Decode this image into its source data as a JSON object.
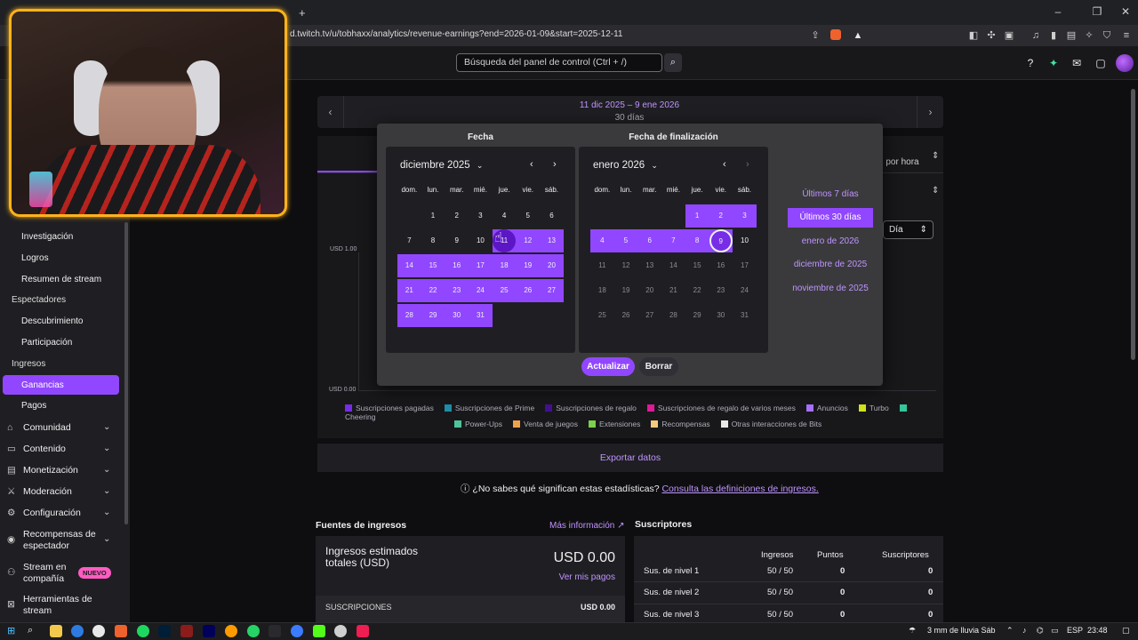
{
  "browser": {
    "url": "d.twitch.tv/u/tobhaxx/analytics/revenue-earnings?end=2026-01-09&start=2025-12-11",
    "new_tab": "+",
    "minimize": "–",
    "maximize": "❐",
    "close": "✕"
  },
  "topnav": {
    "search_placeholder": "Búsqueda del panel de control (Ctrl + /)"
  },
  "sidebar": {
    "items": [
      {
        "label": "Investigación"
      },
      {
        "label": "Logros"
      },
      {
        "label": "Resumen de stream"
      }
    ],
    "head_viewers": "Espectadores",
    "viewer_items": [
      {
        "label": "Descubrimiento"
      },
      {
        "label": "Participación"
      }
    ],
    "head_revenue": "Ingresos",
    "revenue_items": [
      {
        "label": "Ganancias",
        "active": true
      },
      {
        "label": "Pagos"
      }
    ],
    "sections": [
      {
        "label": "Comunidad",
        "icon": "community-icon"
      },
      {
        "label": "Contenido",
        "icon": "content-icon"
      },
      {
        "label": "Monetización",
        "icon": "monetization-icon"
      },
      {
        "label": "Moderación",
        "icon": "moderation-icon"
      },
      {
        "label": "Configuración",
        "icon": "settings-icon"
      },
      {
        "label": "Recompensas de espectador",
        "icon": "rewards-icon"
      },
      {
        "label": "Stream en compañía",
        "icon": "collab-icon"
      },
      {
        "label": "Herramientas de stream",
        "icon": "tools-icon"
      }
    ],
    "new_badge": "NUEVO"
  },
  "daterange": {
    "range": "11 dic 2025 – 9 ene 2026",
    "days": "30 días",
    "prev": "‹",
    "next": "›"
  },
  "chart": {
    "view_select": "d por hora",
    "granularity": "Día",
    "y_top": "USD 1.00",
    "y_bottom": "USD 0.00",
    "legend": [
      {
        "label": "Suscripciones pagadas",
        "color": "#772ce8"
      },
      {
        "label": "Suscripciones de Prime",
        "color": "#1f8fa8"
      },
      {
        "label": "Suscripciones de regalo",
        "color": "#451093"
      },
      {
        "label": "Suscripciones de regalo de varios meses",
        "color": "#e31a9a"
      },
      {
        "label": "Anuncios",
        "color": "#a970ff"
      },
      {
        "label": "Turbo",
        "color": "#d2e41a"
      },
      {
        "label": "Cheering",
        "color": "#33c69b"
      },
      {
        "label": "Power-Ups",
        "color": "#4fc49a"
      },
      {
        "label": "Venta de juegos",
        "color": "#f0a24a"
      },
      {
        "label": "Extensiones",
        "color": "#7bd14a"
      },
      {
        "label": "Recompensas",
        "color": "#f7c97a"
      },
      {
        "label": "Otras interacciones de Bits",
        "color": "#e8e8e8"
      }
    ]
  },
  "export_label": "Exportar datos",
  "help": {
    "question": "¿No sabes qué significan estas estadísticas?",
    "link": "Consulta las definiciones de ingresos."
  },
  "revenue": {
    "title": "Fuentes de ingresos",
    "more": "Más información",
    "estimated_label": "Ingresos estimados totales (USD)",
    "estimated_value": "USD 0.00",
    "payouts_link": "Ver mis pagos",
    "subs_label": "SUSCRIPCIONES",
    "subs_value": "USD 0.00"
  },
  "subscribers": {
    "title": "Suscriptores",
    "columns": [
      "Ingresos",
      "Puntos",
      "Suscriptores"
    ],
    "rows": [
      {
        "tier": "Sus. de nivel 1",
        "revenue": "50 / 50",
        "points": "0",
        "subs": "0"
      },
      {
        "tier": "Sus. de nivel 2",
        "revenue": "50 / 50",
        "points": "0",
        "subs": "0"
      },
      {
        "tier": "Sus. de nivel 3",
        "revenue": "50 / 50",
        "points": "0",
        "subs": "0"
      }
    ]
  },
  "datepicker": {
    "start_title": "Fecha",
    "end_title": "Fecha de finalización",
    "weekdays": [
      "dom.",
      "lun.",
      "mar.",
      "mié.",
      "jue.",
      "vie.",
      "sáb."
    ],
    "left_month": "diciembre 2025",
    "right_month": "enero 2026",
    "left_weeks": [
      [
        "",
        "1",
        "2",
        "3",
        "4",
        "5",
        "6"
      ],
      [
        "7",
        "8",
        "9",
        "10",
        "11",
        "12",
        "13"
      ],
      [
        "14",
        "15",
        "16",
        "17",
        "18",
        "19",
        "20"
      ],
      [
        "21",
        "22",
        "23",
        "24",
        "25",
        "26",
        "27"
      ],
      [
        "28",
        "29",
        "30",
        "31",
        "",
        "",
        ""
      ]
    ],
    "right_weeks": [
      [
        "",
        "",
        "",
        "",
        "1",
        "2",
        "3"
      ],
      [
        "4",
        "5",
        "6",
        "7",
        "8",
        "9",
        "10"
      ],
      [
        "11",
        "12",
        "13",
        "14",
        "15",
        "16",
        "17"
      ],
      [
        "18",
        "19",
        "20",
        "21",
        "22",
        "23",
        "24"
      ],
      [
        "25",
        "26",
        "27",
        "28",
        "29",
        "30",
        "31"
      ]
    ],
    "presets": [
      {
        "label": "Últimos 7 días",
        "active": false
      },
      {
        "label": "Últimos 30 días",
        "active": true
      },
      {
        "label": "enero de 2026",
        "active": false
      },
      {
        "label": "diciembre de 2025",
        "active": false
      },
      {
        "label": "noviembre de 2025",
        "active": false
      }
    ],
    "update_label": "Actualizar",
    "clear_label": "Borrar"
  },
  "taskbar": {
    "weather": "3 mm de lluvia Sáb",
    "lang": "ESP",
    "time": "23:48"
  }
}
